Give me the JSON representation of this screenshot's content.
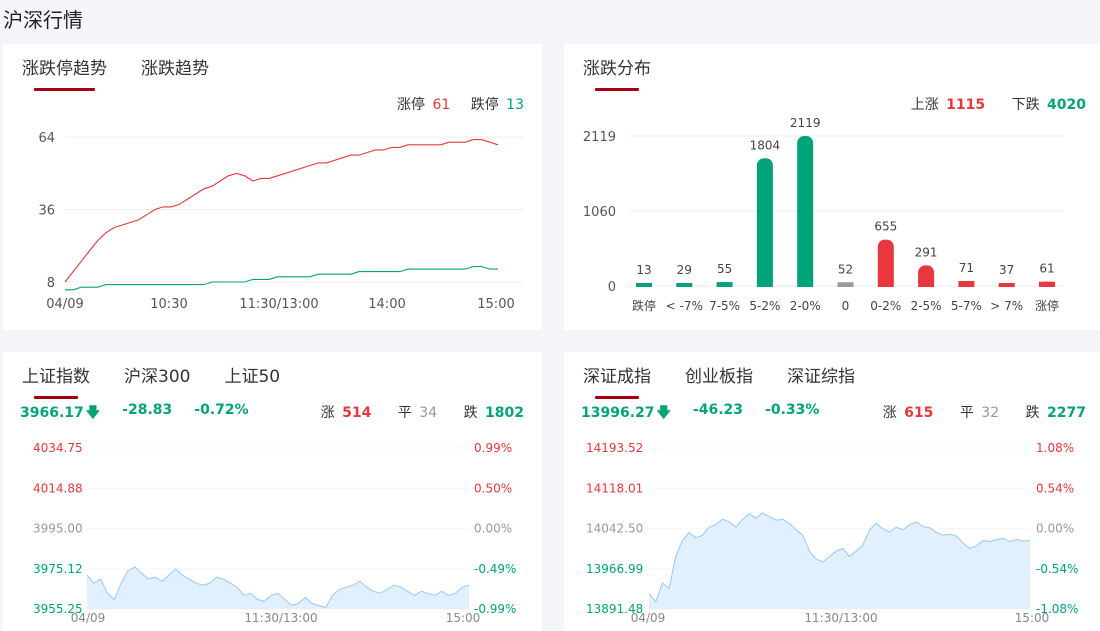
{
  "page": {
    "title": "沪深行情"
  },
  "limit_panel": {
    "tabs": [
      "涨跌停趋势",
      "涨跌趋势"
    ],
    "summary": {
      "up_label": "涨停",
      "up_value": "61",
      "down_label": "跌停",
      "down_value": "13"
    }
  },
  "dist_panel": {
    "tabs": [
      "涨跌分布"
    ],
    "summary": {
      "up_label": "上涨",
      "up_value": "1115",
      "down_label": "下跌",
      "down_value": "4020"
    }
  },
  "sh_panel": {
    "tabs": [
      "上证指数",
      "沪深300",
      "上证50"
    ],
    "price": "3966.17",
    "change": "-28.83",
    "pct": "-0.72%",
    "stats": {
      "up_label": "涨",
      "up": "514",
      "flat_label": "平",
      "flat": "34",
      "down_label": "跌",
      "down": "1802"
    }
  },
  "sz_panel": {
    "tabs": [
      "深证成指",
      "创业板指",
      "深证综指"
    ],
    "price": "13996.27",
    "change": "-46.23",
    "pct": "-0.33%",
    "stats": {
      "up_label": "涨",
      "up": "615",
      "flat_label": "平",
      "flat": "32",
      "down_label": "跌",
      "down": "2277"
    }
  },
  "colors": {
    "red": "#e8383d",
    "green": "#00a37a",
    "gray": "#999999",
    "accent": "#a3000f",
    "area": "#deeeff",
    "area_line": "#9cc7f2"
  },
  "chart_data": [
    {
      "type": "line",
      "name": "limit-trend",
      "x_ticks": [
        "04/09",
        "10:30",
        "11:30/13:00",
        "14:00",
        "15:00"
      ],
      "y_ticks": [
        8,
        36,
        64
      ],
      "ylim": [
        8,
        64
      ],
      "series": [
        {
          "values": [
            8,
            12,
            16,
            20,
            24,
            27,
            29,
            30,
            31,
            32,
            34,
            36,
            37,
            37,
            38,
            40,
            42,
            44,
            45,
            47,
            49,
            50,
            49,
            47,
            48,
            48,
            49,
            50,
            51,
            52,
            53,
            54,
            54,
            55,
            56,
            57,
            57,
            58,
            59,
            59,
            60,
            60,
            61,
            61,
            61,
            61,
            61,
            62,
            62,
            62,
            63,
            63,
            62,
            61
          ]
        },
        {
          "values": [
            5,
            5,
            6,
            6,
            6,
            7,
            7,
            7,
            7,
            7,
            7,
            7,
            7,
            7,
            7,
            7,
            7,
            7,
            8,
            8,
            8,
            8,
            8,
            9,
            9,
            9,
            10,
            10,
            10,
            10,
            10,
            11,
            11,
            11,
            11,
            11,
            12,
            12,
            12,
            12,
            12,
            12,
            13,
            13,
            13,
            13,
            13,
            13,
            13,
            13,
            14,
            14,
            13,
            13
          ]
        }
      ]
    },
    {
      "type": "bar",
      "name": "distribution",
      "categories": [
        "跌停",
        "< -7%",
        "7-5%",
        "5-2%",
        "2-0%",
        "0",
        "0-2%",
        "2-5%",
        "5-7%",
        "> 7%",
        "涨停"
      ],
      "values": [
        13,
        29,
        55,
        1804,
        2119,
        52,
        655,
        291,
        71,
        37,
        61
      ],
      "colors": [
        "green",
        "green",
        "green",
        "green",
        "green",
        "gray",
        "red",
        "red",
        "red",
        "red",
        "red"
      ],
      "y_ticks": [
        0,
        1060,
        2119
      ],
      "ylim": [
        0,
        2119
      ]
    },
    {
      "type": "area",
      "name": "shanghai-index",
      "x_ticks": [
        "04/09",
        "11:30/13:00",
        "15:00"
      ],
      "y_ticks_left": [
        "4034.75",
        "4014.88",
        "3995.00",
        "3975.12",
        "3955.25"
      ],
      "y_ticks_right": [
        "0.99%",
        "0.50%",
        "0.00%",
        "-0.49%",
        "-0.99%"
      ],
      "ylim": [
        3955.25,
        4034.75
      ],
      "values": [
        3972,
        3968,
        3970,
        3963,
        3960,
        3968,
        3974,
        3976,
        3973,
        3970,
        3971,
        3969,
        3972,
        3975,
        3972,
        3970,
        3968,
        3967,
        3968,
        3971,
        3970,
        3968,
        3966,
        3962,
        3963,
        3960,
        3959,
        3962,
        3963,
        3960,
        3957,
        3958,
        3961,
        3958,
        3957,
        3956,
        3962,
        3965,
        3966,
        3967,
        3969,
        3966,
        3964,
        3963,
        3965,
        3967,
        3966,
        3964,
        3962,
        3964,
        3963,
        3962,
        3964,
        3962,
        3963,
        3966,
        3967
      ]
    },
    {
      "type": "area",
      "name": "shenzhen-index",
      "x_ticks": [
        "04/09",
        "11:30/13:00",
        "15:00"
      ],
      "y_ticks_left": [
        "14193.52",
        "14118.01",
        "14042.50",
        "13966.99",
        "13891.48"
      ],
      "y_ticks_right": [
        "1.08%",
        "0.54%",
        "0.00%",
        "-0.54%",
        "-1.08%"
      ],
      "ylim": [
        13891.48,
        14193.52
      ],
      "values": [
        13920,
        13905,
        13940,
        13930,
        13990,
        14020,
        14035,
        14025,
        14030,
        14045,
        14050,
        14060,
        14055,
        14045,
        14060,
        14070,
        14062,
        14072,
        14065,
        14058,
        14060,
        14052,
        14040,
        14030,
        14000,
        13985,
        13980,
        13990,
        14000,
        14005,
        13990,
        14000,
        14012,
        14040,
        14052,
        14042,
        14036,
        14045,
        14040,
        14050,
        14055,
        14046,
        14044,
        14035,
        14030,
        14032,
        14028,
        14015,
        14005,
        14010,
        14020,
        14018,
        14022,
        14024,
        14018,
        14022,
        14019,
        14020
      ]
    }
  ]
}
